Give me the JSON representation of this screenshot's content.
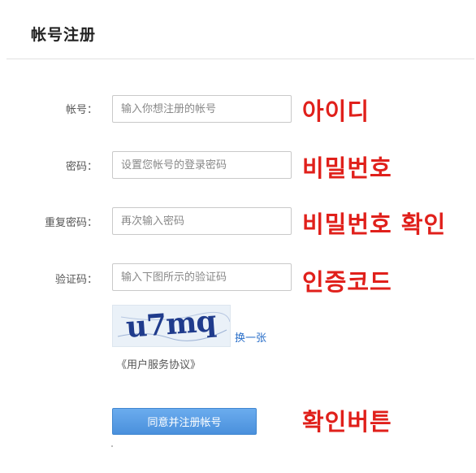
{
  "header": {
    "title": "帐号注册"
  },
  "form": {
    "account": {
      "label": "帐号：",
      "placeholder": "输入你想注册的帐号",
      "annotation": "아이디"
    },
    "password": {
      "label": "密码：",
      "placeholder": "设置您帐号的登录密码",
      "annotation": "비밀번호"
    },
    "confirm_password": {
      "label": "重复密码：",
      "placeholder": "再次输入密码",
      "annotation": "비밀번호 확인"
    },
    "captcha": {
      "label": "验证码：",
      "placeholder": "输入下图所示的验证码",
      "annotation": "인증코드",
      "image_text": "u7mq",
      "refresh_label": "换一张"
    },
    "agreement_link": "《用户服务协议》",
    "submit": {
      "label": "同意并注册帐号",
      "annotation": "확인버튼"
    }
  },
  "colors": {
    "annotation": "#e0201b",
    "button": "#4a90dc",
    "link": "#2a6fc9"
  }
}
